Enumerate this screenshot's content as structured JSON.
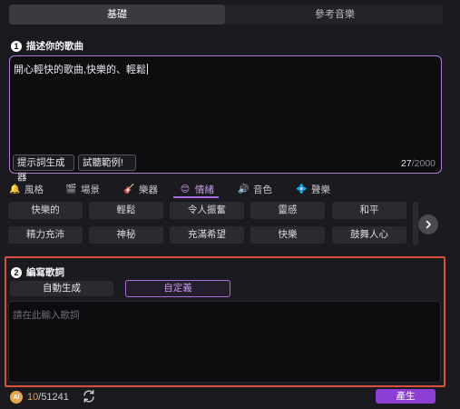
{
  "tabs": {
    "basic": "基礎",
    "reference": "參考音樂"
  },
  "describe": {
    "number": "1",
    "title": "描述你的歌曲",
    "text": "開心輕快的歌曲,快樂的、輕鬆",
    "hint_button": "提示詞生成器",
    "example_button": "試聽範例!",
    "count_current": "27",
    "count_sep": "/",
    "count_max": "2000"
  },
  "categories": [
    {
      "icon": "🔔",
      "label": "風格"
    },
    {
      "icon": "🎬",
      "label": "場景"
    },
    {
      "icon": "🎸",
      "label": "樂器"
    },
    {
      "icon": "😊",
      "label": "情緒"
    },
    {
      "icon": "🔊",
      "label": "音色"
    },
    {
      "icon": "💠",
      "label": "聲樂"
    }
  ],
  "active_category": "情緒",
  "tags": [
    [
      "快樂的",
      "輕鬆",
      "令人振奮",
      "靈感",
      "和平"
    ],
    [
      "精力充沛",
      "神秘",
      "充滿希望",
      "快樂",
      "鼓舞人心"
    ]
  ],
  "lyrics": {
    "number": "2",
    "title": "編寫歌詞",
    "auto_tab": "自動生成",
    "custom_tab": "自定義",
    "placeholder": "請在此輸入歌詞"
  },
  "credits": {
    "icon_text": "AI",
    "used": "10",
    "sep": "/",
    "total": "51241"
  },
  "generate_button": "產生",
  "colors": {
    "accent": "#8e3fd3",
    "highlight_border": "#d9503f",
    "coin": "#e6a64a"
  }
}
